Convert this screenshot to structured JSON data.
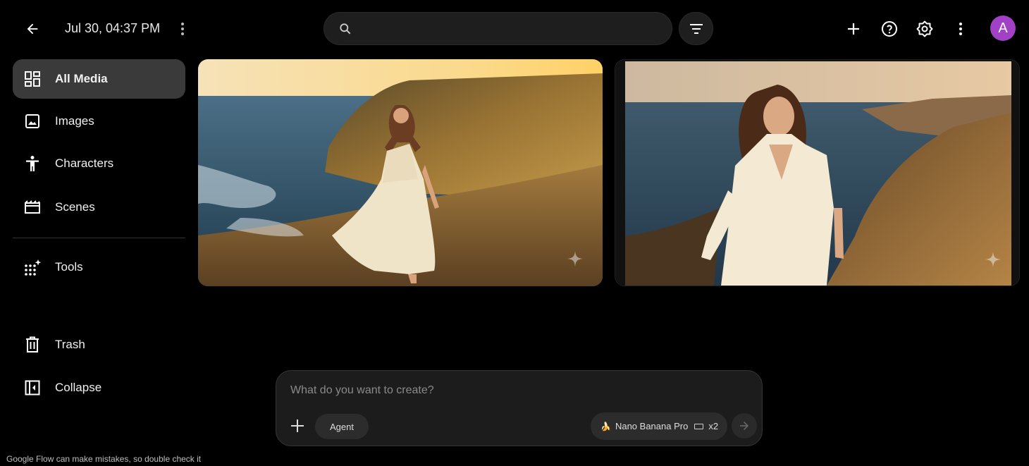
{
  "header": {
    "project_title": "Jul 30, 04:37 PM",
    "search_placeholder": "",
    "avatar_initial": "A"
  },
  "sidebar": {
    "items": [
      {
        "label": "All Media",
        "icon": "grid-icon",
        "active": true
      },
      {
        "label": "Images",
        "icon": "image-icon"
      },
      {
        "label": "Characters",
        "icon": "person-icon"
      },
      {
        "label": "Scenes",
        "icon": "clapperboard-icon"
      },
      {
        "label": "Tools",
        "icon": "tools-sparkle-icon"
      },
      {
        "label": "Trash",
        "icon": "trash-icon"
      },
      {
        "label": "Collapse",
        "icon": "collapse-sidebar-icon"
      }
    ]
  },
  "composer": {
    "placeholder": "What do you want to create?",
    "agent_label": "Agent",
    "model_label": "Nano Banana Pro",
    "count_label": "x2"
  },
  "disclaimer": "Google Flow can make mistakes, so double check it",
  "colors": {
    "background": "#000000",
    "avatar": "#a142c6",
    "active_nav": "#3a3a3a"
  }
}
